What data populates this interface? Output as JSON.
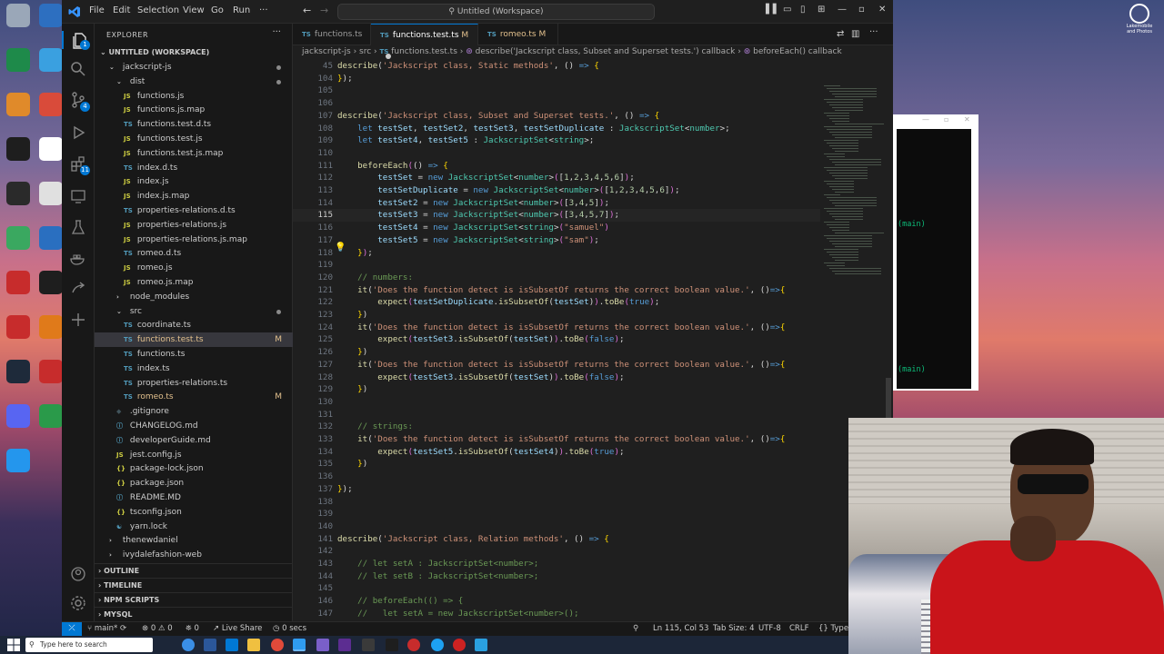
{
  "window": {
    "menu": [
      "File",
      "Edit",
      "Selection",
      "View",
      "Go",
      "Run",
      "···"
    ],
    "command_center": "Untitled (Workspace)"
  },
  "explorer": {
    "title": "EXPLORER",
    "workspace": "UNTITLED (WORKSPACE)",
    "items": [
      {
        "indent": 1,
        "type": "folder-open",
        "label": "jackscript-js",
        "dot": true
      },
      {
        "indent": 2,
        "type": "folder-open",
        "label": "dist",
        "dot": true
      },
      {
        "indent": 3,
        "type": "js",
        "label": "functions.js"
      },
      {
        "indent": 3,
        "type": "js",
        "label": "functions.js.map"
      },
      {
        "indent": 3,
        "type": "ts",
        "label": "functions.test.d.ts"
      },
      {
        "indent": 3,
        "type": "js",
        "label": "functions.test.js"
      },
      {
        "indent": 3,
        "type": "js",
        "label": "functions.test.js.map"
      },
      {
        "indent": 3,
        "type": "ts",
        "label": "index.d.ts"
      },
      {
        "indent": 3,
        "type": "js",
        "label": "index.js"
      },
      {
        "indent": 3,
        "type": "js",
        "label": "index.js.map"
      },
      {
        "indent": 3,
        "type": "ts",
        "label": "properties-relations.d.ts"
      },
      {
        "indent": 3,
        "type": "js",
        "label": "properties-relations.js"
      },
      {
        "indent": 3,
        "type": "js",
        "label": "properties-relations.js.map"
      },
      {
        "indent": 3,
        "type": "ts",
        "label": "romeo.d.ts"
      },
      {
        "indent": 3,
        "type": "js",
        "label": "romeo.js"
      },
      {
        "indent": 3,
        "type": "js",
        "label": "romeo.js.map"
      },
      {
        "indent": 2,
        "type": "folder",
        "label": "node_modules"
      },
      {
        "indent": 2,
        "type": "folder-open",
        "label": "src",
        "dot": true
      },
      {
        "indent": 3,
        "type": "ts",
        "label": "coordinate.ts"
      },
      {
        "indent": 3,
        "type": "ts",
        "label": "functions.test.ts",
        "mod": "M",
        "selected": true
      },
      {
        "indent": 3,
        "type": "ts",
        "label": "functions.ts"
      },
      {
        "indent": 3,
        "type": "ts",
        "label": "index.ts"
      },
      {
        "indent": 3,
        "type": "ts",
        "label": "properties-relations.ts"
      },
      {
        "indent": 3,
        "type": "ts",
        "label": "romeo.ts",
        "mod": "M"
      },
      {
        "indent": 2,
        "type": "git",
        "label": ".gitignore"
      },
      {
        "indent": 2,
        "type": "md",
        "label": "CHANGELOG.md"
      },
      {
        "indent": 2,
        "type": "md",
        "label": "developerGuide.md"
      },
      {
        "indent": 2,
        "type": "js",
        "label": "jest.config.js"
      },
      {
        "indent": 2,
        "type": "json",
        "label": "package-lock.json"
      },
      {
        "indent": 2,
        "type": "json",
        "label": "package.json"
      },
      {
        "indent": 2,
        "type": "md",
        "label": "README.MD"
      },
      {
        "indent": 2,
        "type": "json",
        "label": "tsconfig.json"
      },
      {
        "indent": 2,
        "type": "yarn",
        "label": "yarn.lock"
      },
      {
        "indent": 1,
        "type": "folder",
        "label": "thenewdaniel"
      },
      {
        "indent": 1,
        "type": "folder",
        "label": "ivydalefashion-web"
      }
    ],
    "sections": [
      "OUTLINE",
      "TIMELINE",
      "NPM SCRIPTS",
      "MYSQL"
    ]
  },
  "tabs": [
    {
      "label": "functions.ts",
      "mod": "",
      "active": false
    },
    {
      "label": "functions.test.ts",
      "mod": "M",
      "active": true,
      "dirty": true
    },
    {
      "label": "romeo.ts",
      "mod": "M",
      "active": false
    }
  ],
  "breadcrumb": [
    "jackscript-js",
    "src",
    "functions.test.ts",
    "describe('Jackscript class, Subset and Superset tests.') callback",
    "beforeEach() callback"
  ],
  "code_lines": [
    {
      "n": "45",
      "html": "<span class='f'>describe</span>(<span class='s'>'Jackscript class, Static methods'</span>, () <span class='k'>=&gt;</span> <span class='y'>{</span>"
    },
    {
      "n": "104",
      "html": "<span class='y'>}</span>);"
    },
    {
      "n": "105",
      "html": ""
    },
    {
      "n": "106",
      "html": ""
    },
    {
      "n": "107",
      "html": "<span class='f'>describe</span>(<span class='s'>'Jackscript class, Subset and Superset tests.'</span>, () <span class='k'>=&gt;</span> <span class='y'>{</span>"
    },
    {
      "n": "108",
      "html": "    <span class='k'>let</span> <span class='v'>testSet</span>, <span class='v'>testSet2</span>, <span class='v'>testSet3</span>, <span class='v'>testSetDuplicate</span> : <span class='t'>JackscriptSet</span>&lt;<span class='t'>number</span>&gt;;"
    },
    {
      "n": "109",
      "html": "    <span class='k'>let</span> <span class='v'>testSet4</span>, <span class='v'>testSet5</span> : <span class='t'>JackscriptSet</span>&lt;<span class='t'>string</span>&gt;;"
    },
    {
      "n": "110",
      "html": ""
    },
    {
      "n": "111",
      "html": "    <span class='f'>beforeEach</span><span class='p'>(</span>() <span class='k'>=&gt;</span> <span class='y'>{</span>"
    },
    {
      "n": "112",
      "html": "        <span class='v'>testSet</span> = <span class='k'>new</span> <span class='t'>JackscriptSet</span>&lt;<span class='t'>number</span>&gt;<span class='p'>(</span>[<span class='n'>1</span>,<span class='n'>2</span>,<span class='n'>3</span>,<span class='n'>4</span>,<span class='n'>5</span>,<span class='n'>6</span>]<span class='p'>)</span>;"
    },
    {
      "n": "113",
      "html": "        <span class='v'>testSetDuplicate</span> = <span class='k'>new</span> <span class='t'>JackscriptSet</span>&lt;<span class='t'>number</span>&gt;<span class='p'>(</span>[<span class='n'>1</span>,<span class='n'>2</span>,<span class='n'>3</span>,<span class='n'>4</span>,<span class='n'>5</span>,<span class='n'>6</span>]<span class='p'>)</span>;"
    },
    {
      "n": "114",
      "html": "        <span class='v'>testSet2</span> = <span class='k'>new</span> <span class='t'>JackscriptSet</span>&lt;<span class='t'>number</span>&gt;<span class='p'>(</span>[<span class='n'>3</span>,<span class='n'>4</span>,<span class='n'>5</span>]<span class='p'>)</span>;"
    },
    {
      "n": "115",
      "html": "        <span class='v'>testSet3</span> = <span class='k'>new</span> <span class='t'>JackscriptSet</span>&lt;<span class='t'>number</span>&gt;<span class='p'>(</span>[<span class='n'>3</span>,<span class='n'>4</span>,<span class='n'>5</span>,<span class='n'>7</span>]<span class='p'>)</span>;"
    },
    {
      "n": "116",
      "html": "        <span class='v'>testSet4</span> = <span class='k'>new</span> <span class='t'>JackscriptSet</span>&lt;<span class='t'>string</span>&gt;<span class='p'>(</span><span class='s'>\"samuel\"</span><span class='p'>)</span>"
    },
    {
      "n": "117",
      "html": "        <span class='v'>testSet5</span> = <span class='k'>new</span> <span class='t'>JackscriptSet</span>&lt;<span class='t'>string</span>&gt;<span class='p'>(</span><span class='s'>\"sam\"</span><span class='p'>)</span>;"
    },
    {
      "n": "118",
      "html": "    <span class='y'>}</span><span class='p'>)</span>;"
    },
    {
      "n": "119",
      "html": ""
    },
    {
      "n": "120",
      "html": "    <span class='c'>// numbers:</span>"
    },
    {
      "n": "121",
      "html": "    <span class='f'>it</span>(<span class='s'>'Does the function detect is isSubsetOf returns the correct boolean value.'</span>, ()<span class='k'>=&gt;</span><span class='y'>{</span>"
    },
    {
      "n": "122",
      "html": "        <span class='f'>expect</span><span class='p'>(</span><span class='v'>testSetDuplicate</span>.<span class='f'>isSubsetOf</span>(<span class='v'>testSet</span>)<span class='p'>)</span>.<span class='f'>toBe</span><span class='p'>(</span><span class='k'>true</span><span class='p'>)</span>;"
    },
    {
      "n": "123",
      "html": "    <span class='y'>}</span>)"
    },
    {
      "n": "124",
      "html": "    <span class='f'>it</span>(<span class='s'>'Does the function detect is isSubsetOf returns the correct boolean value.'</span>, ()<span class='k'>=&gt;</span><span class='y'>{</span>"
    },
    {
      "n": "125",
      "html": "        <span class='f'>expect</span><span class='p'>(</span><span class='v'>testSet3</span>.<span class='f'>isSubsetOf</span>(<span class='v'>testSet</span>)<span class='p'>)</span>.<span class='f'>toBe</span><span class='p'>(</span><span class='k'>false</span><span class='p'>)</span>;"
    },
    {
      "n": "126",
      "html": "    <span class='y'>}</span>)"
    },
    {
      "n": "127",
      "html": "    <span class='f'>it</span>(<span class='s'>'Does the function detect is isSubsetOf returns the correct boolean value.'</span>, ()<span class='k'>=&gt;</span><span class='y'>{</span>"
    },
    {
      "n": "128",
      "html": "        <span class='f'>expect</span><span class='p'>(</span><span class='v'>testSet3</span>.<span class='f'>isSubsetOf</span>(<span class='v'>testSet</span>)<span class='p'>)</span>.<span class='f'>toBe</span><span class='p'>(</span><span class='k'>false</span><span class='p'>)</span>;"
    },
    {
      "n": "129",
      "html": "    <span class='y'>}</span>)"
    },
    {
      "n": "130",
      "html": ""
    },
    {
      "n": "131",
      "html": ""
    },
    {
      "n": "132",
      "html": "    <span class='c'>// strings:</span>"
    },
    {
      "n": "133",
      "html": "    <span class='f'>it</span>(<span class='s'>'Does the function detect is isSubsetOf returns the correct boolean value.'</span>, ()<span class='k'>=&gt;</span><span class='y'>{</span>"
    },
    {
      "n": "134",
      "html": "        <span class='f'>expect</span><span class='p'>(</span><span class='v'>testSet5</span>.<span class='f'>isSubsetOf</span>(<span class='v'>testSet4</span>)<span class='p'>)</span>.<span class='f'>toBe</span><span class='p'>(</span><span class='k'>true</span><span class='p'>)</span>;"
    },
    {
      "n": "135",
      "html": "    <span class='y'>}</span>)"
    },
    {
      "n": "136",
      "html": ""
    },
    {
      "n": "137",
      "html": "<span class='y'>}</span>);"
    },
    {
      "n": "138",
      "html": ""
    },
    {
      "n": "139",
      "html": ""
    },
    {
      "n": "140",
      "html": ""
    },
    {
      "n": "141",
      "html": "<span class='f'>describe</span>(<span class='s'>'Jackscript class, Relation methods'</span>, () <span class='k'>=&gt;</span> <span class='y'>{</span>"
    },
    {
      "n": "142",
      "html": ""
    },
    {
      "n": "143",
      "html": "    <span class='c'>// let setA : JackscriptSet&lt;number&gt;;</span>"
    },
    {
      "n": "144",
      "html": "    <span class='c'>// let setB : JackscriptSet&lt;number&gt;;</span>"
    },
    {
      "n": "145",
      "html": ""
    },
    {
      "n": "146",
      "html": "    <span class='c'>// beforeEach(() =&gt; {</span>"
    },
    {
      "n": "147",
      "html": "    <span class='c'>//   let setA = new JackscriptSet&lt;number&gt;();</span>"
    }
  ],
  "statusbar": {
    "branch": "main*",
    "sync": "",
    "errors": "0",
    "warnings": "0",
    "ports": "0",
    "live_share": "Live Share",
    "timer": "0 secs",
    "position": "Ln 115, Col 53",
    "tab_size": "Tab Size: 4",
    "encoding": "UTF-8",
    "eol": "CRLF",
    "language": "TypeS"
  },
  "terminal": {
    "lines": [
      "(main)",
      "(main)"
    ]
  },
  "taskbar": {
    "search_placeholder": "Type here to search"
  },
  "desktop_right_label": "Lakemobile and Photos"
}
